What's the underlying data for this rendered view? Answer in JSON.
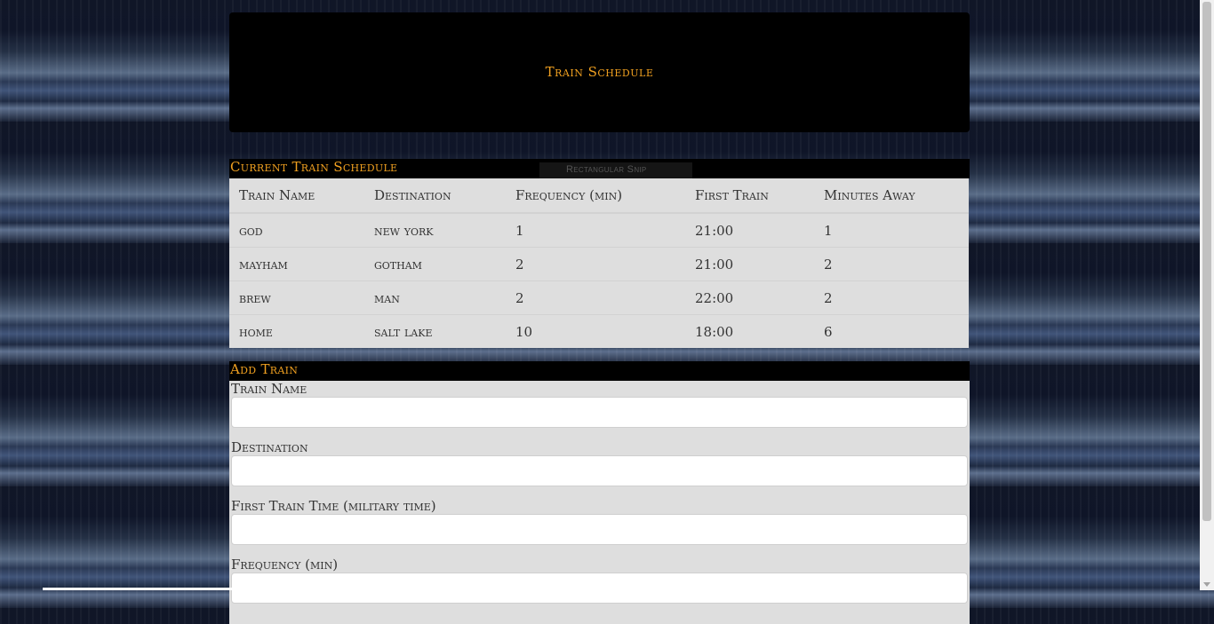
{
  "header": {
    "title": "Train Schedule"
  },
  "schedule": {
    "heading": "Current Train Schedule",
    "columns": [
      "Train Name",
      "Destination",
      "Frequency (min)",
      "First Train",
      "Minutes Away"
    ],
    "rows": [
      [
        "god",
        "new york",
        "1",
        "21:00",
        "1"
      ],
      [
        "mayham",
        "gotham",
        "2",
        "21:00",
        "2"
      ],
      [
        "brew",
        "man",
        "2",
        "22:00",
        "2"
      ],
      [
        "home",
        "salt lake",
        "10",
        "18:00",
        "6"
      ]
    ],
    "overlay_text": "Rectangular Snip"
  },
  "add_train": {
    "heading": "Add Train",
    "fields": [
      {
        "label": "Train Name",
        "value": "",
        "placeholder": ""
      },
      {
        "label": "Destination",
        "value": "",
        "placeholder": ""
      },
      {
        "label": "First Train Time (military time)",
        "value": "",
        "placeholder": ""
      },
      {
        "label": "Frequency (min)",
        "value": "",
        "placeholder": ""
      }
    ]
  },
  "colors": {
    "accent": "#f0a020",
    "panel": "#dedede",
    "header_bg": "#000000"
  }
}
